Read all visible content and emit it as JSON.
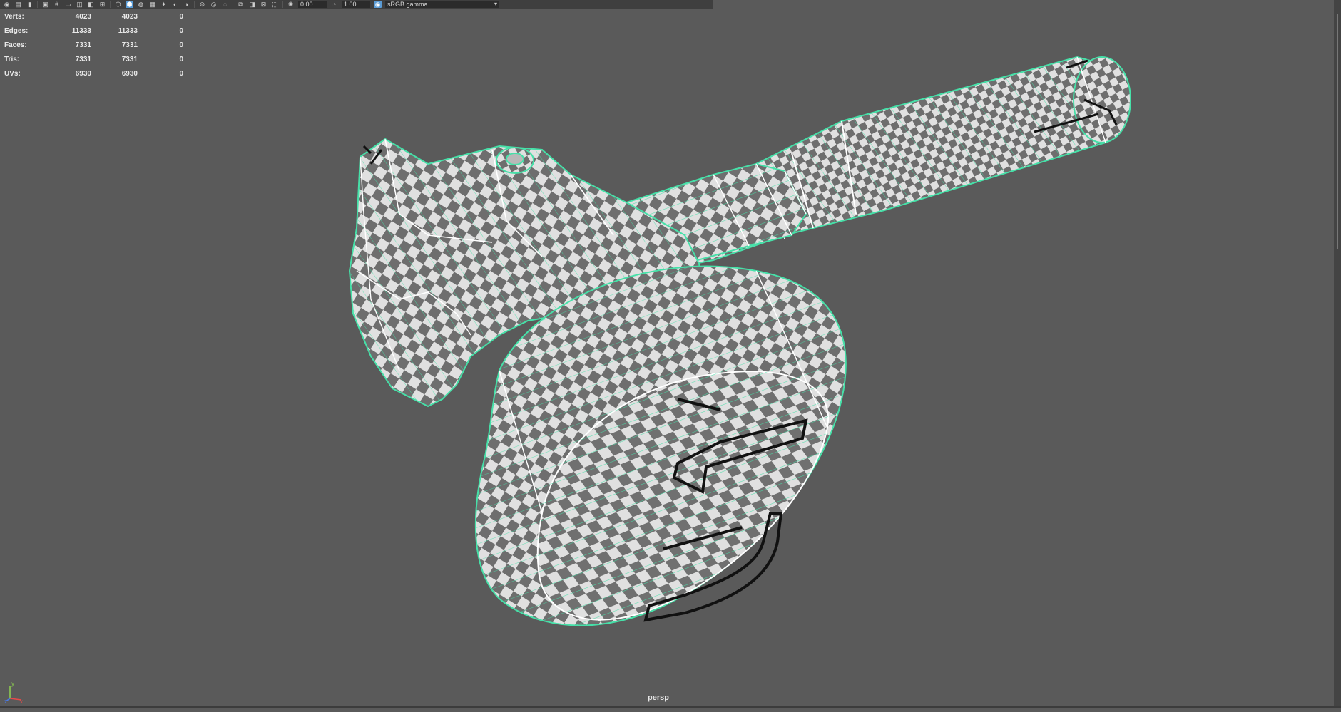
{
  "toolbar": {
    "icons": [
      "camera-icon",
      "film-icon",
      "bookmark-icon",
      "image-plane-icon",
      "grid-icon",
      "film-gate-icon",
      "resolution-gate-icon",
      "gate-mask-icon",
      "field-chart-icon",
      "safe-action-icon",
      "safe-title-icon",
      "wireframe-icon",
      "smooth-shade-icon",
      "default-material-icon",
      "textured-icon",
      "lights-icon",
      "shadows-icon",
      "ambient-occlusion-icon",
      "motion-blur-icon",
      "anti-alias-icon",
      "depth-of-field-icon",
      "isolate-select-icon",
      "xray-icon",
      "xray-joints-icon",
      "backface-icon",
      "exposure-icon",
      "gamma-icon"
    ],
    "exposure_value": "0.00",
    "gamma_value": "1.00",
    "color_space": "sRGB gamma"
  },
  "hud": {
    "rows": [
      {
        "label": "Verts:",
        "v1": "4023",
        "v2": "4023",
        "v3": "0"
      },
      {
        "label": "Edges:",
        "v1": "11333",
        "v2": "11333",
        "v3": "0"
      },
      {
        "label": "Faces:",
        "v1": "7331",
        "v2": "7331",
        "v3": "0"
      },
      {
        "label": "Tris:",
        "v1": "7331",
        "v2": "7331",
        "v3": "0"
      },
      {
        "label": "UVs:",
        "v1": "6930",
        "v2": "6930",
        "v3": "0"
      }
    ]
  },
  "viewport": {
    "camera_name": "persp",
    "wire_color": "#46e0a8",
    "checker_dark": "#6e6e6e",
    "checker_light": "#e0e0e0",
    "background": "#5a5a5a"
  },
  "axis": {
    "x": "x",
    "y": "y",
    "z": "z"
  }
}
